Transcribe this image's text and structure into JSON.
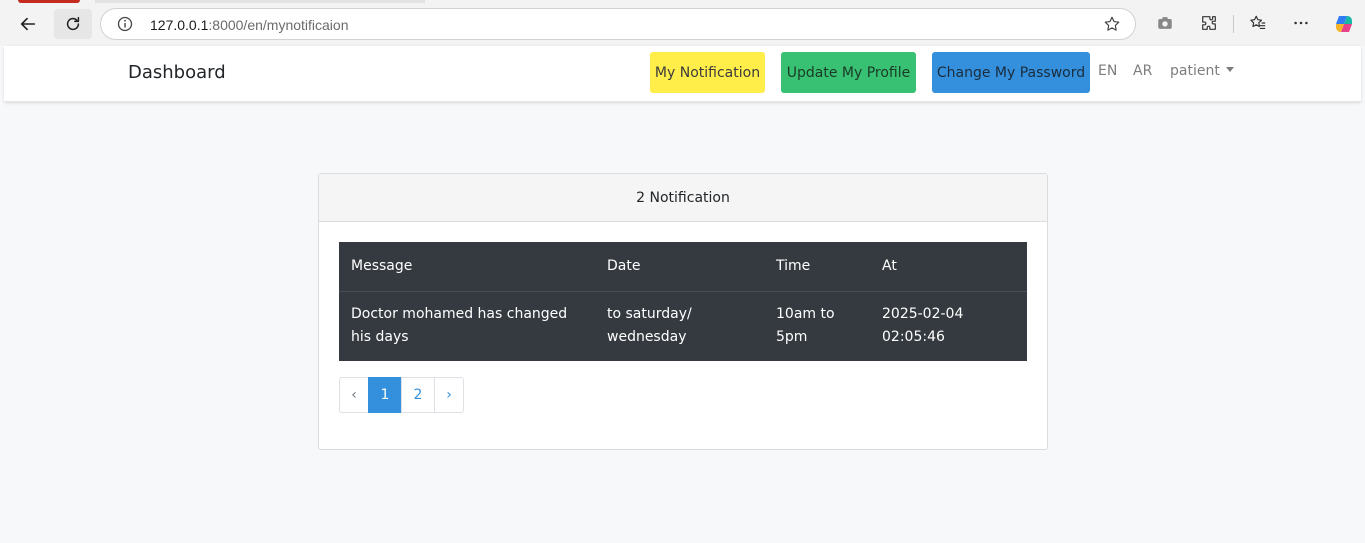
{
  "browser": {
    "url_host": "127.0.0.1",
    "url_rest": ":8000/en/mynotificaion"
  },
  "navbar": {
    "brand": "Dashboard",
    "buttons": {
      "notification": "My Notification",
      "profile": "Update My Profile",
      "password": "Change My Password"
    },
    "lang_en": "EN",
    "lang_ar": "AR",
    "user": "patient"
  },
  "card": {
    "header": "2 Notification",
    "table": {
      "headers": [
        "Message",
        "Date",
        "Time",
        "At"
      ],
      "rows": [
        [
          "Doctor mohamed has changed his days",
          "to saturday/ wednesday",
          "10am to 5pm",
          "2025-02-04 02:05:46"
        ]
      ]
    },
    "pagination": {
      "prev": "‹",
      "pages": [
        "1",
        "2"
      ],
      "active_page": "1",
      "next": "›"
    }
  },
  "colors": {
    "notification_btn": "#ffed4a",
    "profile_btn": "#38c172",
    "password_btn": "#3490dc",
    "table_bg": "#343a40"
  }
}
